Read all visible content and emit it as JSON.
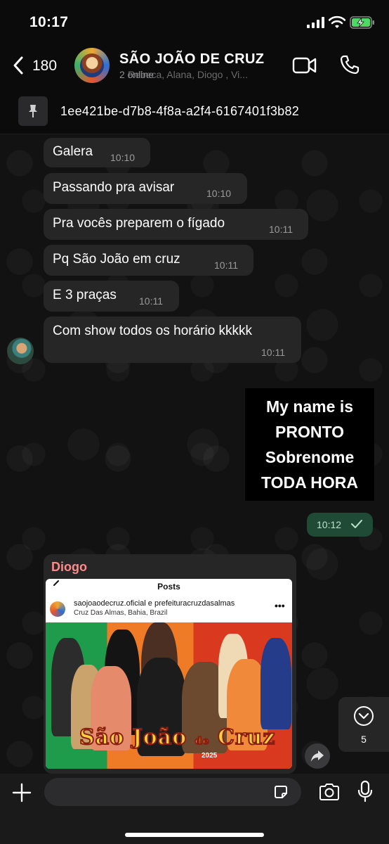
{
  "status": {
    "time": "10:17"
  },
  "header": {
    "back_count": "180",
    "title": "SÃO JOÃO DE CRUZ",
    "subtitle": "2 online",
    "subtitle_ghost": "Rebeca, Alana, Diogo , Vi..."
  },
  "pinned": {
    "text": "1ee421be-d7b8-4f8a-a2f4-6167401f3b82"
  },
  "messages": [
    {
      "text": "Galera",
      "time": "10:10"
    },
    {
      "text": "Passando pra avisar",
      "time": "10:10"
    },
    {
      "text": "Pra vocês preparem o fígado",
      "time": "10:11"
    },
    {
      "text": "Pq São João em cruz",
      "time": "10:11"
    },
    {
      "text": "E 3 praças",
      "time": "10:11"
    },
    {
      "text": "Com show todos os horário kkkkk",
      "time": "10:11"
    }
  ],
  "sent": {
    "lines": [
      "My name is",
      "PRONTO",
      "Sobrenome",
      "TODA HORA"
    ],
    "time": "10:12"
  },
  "image_message": {
    "sender": "Diogo",
    "screenshot": {
      "header": "Posts",
      "account": "saojoaodecruz.oficial e prefeituracruzdasalmas",
      "location": "Cruz Das Almas, Bahia, Brazil",
      "more": "•••",
      "banner": "São João",
      "banner_de": "de",
      "banner_end": "Cruz",
      "year": "2025"
    }
  },
  "scroll_down": {
    "count": "5"
  },
  "composer": {
    "placeholder": ""
  },
  "colors": {
    "sent_bubble": "#1e4a36",
    "received_bubble": "#262627",
    "sender_name": "#ff8a8a"
  }
}
